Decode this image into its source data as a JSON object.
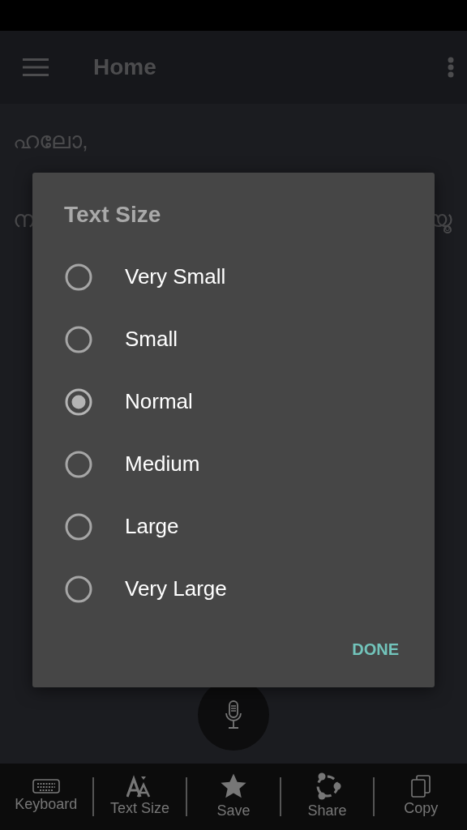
{
  "app_bar": {
    "title": "Home"
  },
  "content": {
    "greeting": "ഹലോ,",
    "line_start": "ന",
    "line_end": "യൂ"
  },
  "dialog": {
    "title": "Text Size",
    "options": [
      {
        "label": "Very Small",
        "selected": false
      },
      {
        "label": "Small",
        "selected": false
      },
      {
        "label": "Normal",
        "selected": true
      },
      {
        "label": "Medium",
        "selected": false
      },
      {
        "label": "Large",
        "selected": false
      },
      {
        "label": "Very Large",
        "selected": false
      }
    ],
    "done": "DONE"
  },
  "toolbar": [
    {
      "kind": "keyboard",
      "label": "Keyboard"
    },
    {
      "kind": "textsize",
      "label": "Text Size"
    },
    {
      "kind": "save",
      "label": "Save"
    },
    {
      "kind": "share",
      "label": "Share"
    },
    {
      "kind": "copy",
      "label": "Copy"
    }
  ]
}
